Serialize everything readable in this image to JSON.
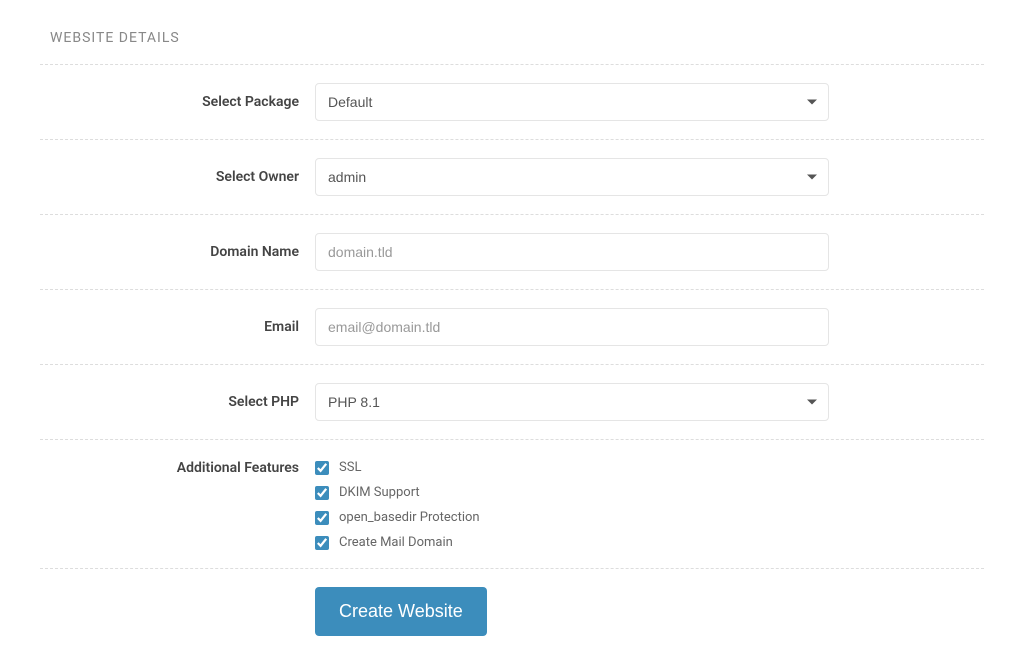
{
  "section_title": "WEBSITE DETAILS",
  "fields": {
    "package": {
      "label": "Select Package",
      "value": "Default"
    },
    "owner": {
      "label": "Select Owner",
      "value": "admin"
    },
    "domain": {
      "label": "Domain Name",
      "placeholder": "domain.tld",
      "value": ""
    },
    "email": {
      "label": "Email",
      "placeholder": "email@domain.tld",
      "value": ""
    },
    "php": {
      "label": "Select PHP",
      "value": "PHP 8.1"
    },
    "features": {
      "label": "Additional Features",
      "items": [
        {
          "label": "SSL",
          "checked": true
        },
        {
          "label": "DKIM Support",
          "checked": true
        },
        {
          "label": "open_basedir Protection",
          "checked": true
        },
        {
          "label": "Create Mail Domain",
          "checked": true
        }
      ]
    }
  },
  "submit_label": "Create Website"
}
